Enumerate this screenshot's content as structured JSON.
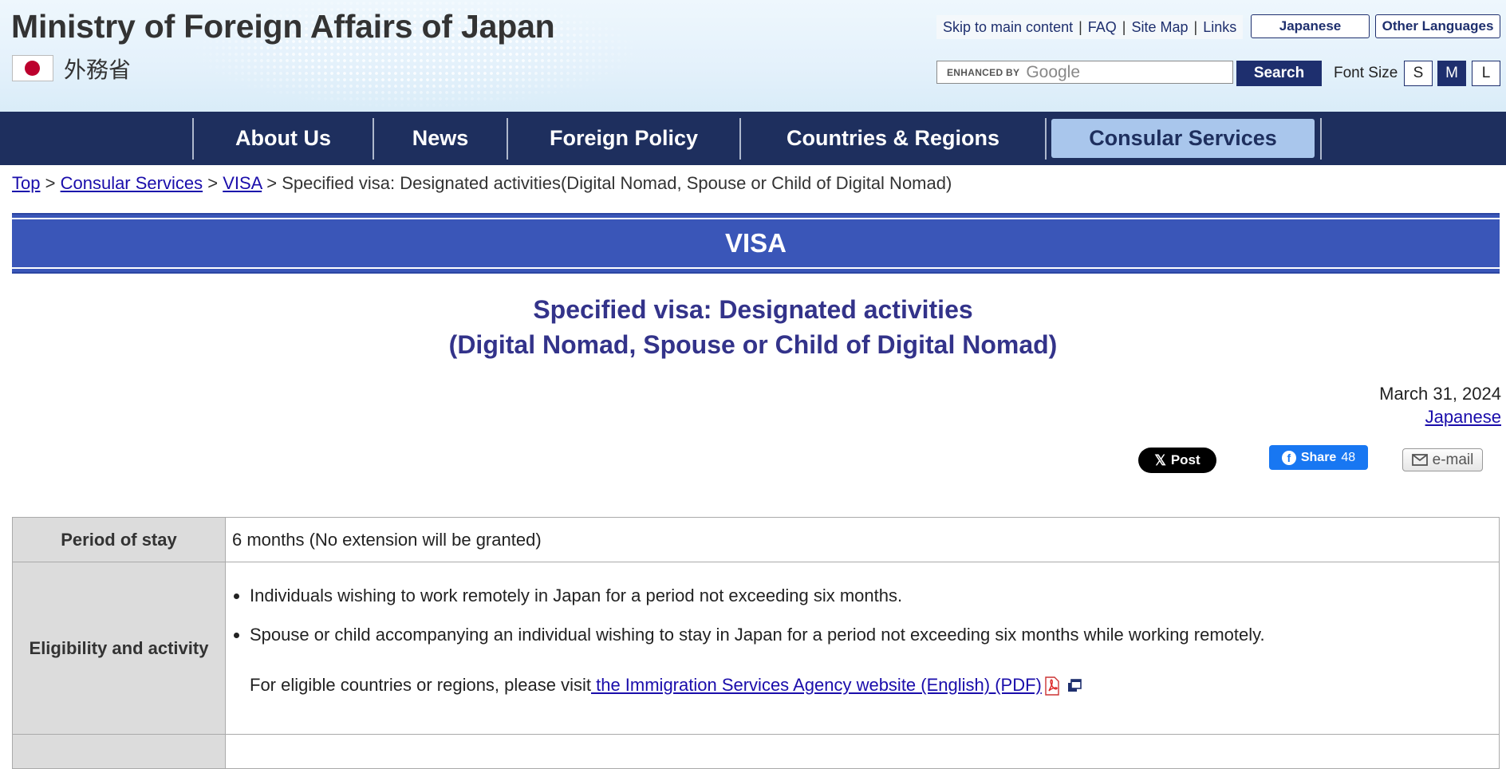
{
  "header": {
    "site_title": "Ministry of Foreign Affairs of Japan",
    "jp_name": "外務省",
    "util_links": [
      "Skip to main content",
      "FAQ",
      "Site Map",
      "Links"
    ],
    "lang_japanese": "Japanese",
    "lang_other": "Other Languages",
    "search_enhanced": "ENHANCED BY",
    "search_brand": "Google",
    "search_button": "Search",
    "font_size_label": "Font Size",
    "font_sizes": [
      "S",
      "M",
      "L"
    ],
    "font_size_selected": "M"
  },
  "nav": {
    "items": [
      "About Us",
      "News",
      "Foreign Policy",
      "Countries & Regions",
      "Consular Services"
    ],
    "active": "Consular Services"
  },
  "breadcrumb": {
    "links": [
      "Top",
      "Consular Services",
      "VISA"
    ],
    "separator": ">",
    "current": "Specified visa: Designated activities(Digital Nomad, Spouse or Child of Digital Nomad)"
  },
  "banner": "VISA",
  "page_title": {
    "line1": "Specified visa: Designated activities",
    "line2": "(Digital Nomad, Spouse or Child of Digital Nomad)"
  },
  "date": "March 31, 2024",
  "japanese_link": "Japanese",
  "social": {
    "x_post": "Post",
    "fb_share": "Share",
    "fb_count": "48",
    "email": "e-mail"
  },
  "table": {
    "period_label": "Period of stay",
    "period_value": "6 months (No extension will be granted)",
    "eligibility_label": "Eligibility and activity",
    "eligibility_items": [
      "Individuals wishing to work remotely in Japan for a period not exceeding six months.",
      "Spouse or child accompanying an individual wishing to stay in Japan for a period not exceeding six months while working remotely."
    ],
    "note_text": "For eligible countries or regions, please visit",
    "note_link": " the Immigration Services Agency website (English) (PDF)"
  },
  "colors": {
    "nav_bg": "#1e2f5e",
    "nav_active": "#a9c6ec",
    "banner": "#3a56b8",
    "title": "#33338a"
  }
}
